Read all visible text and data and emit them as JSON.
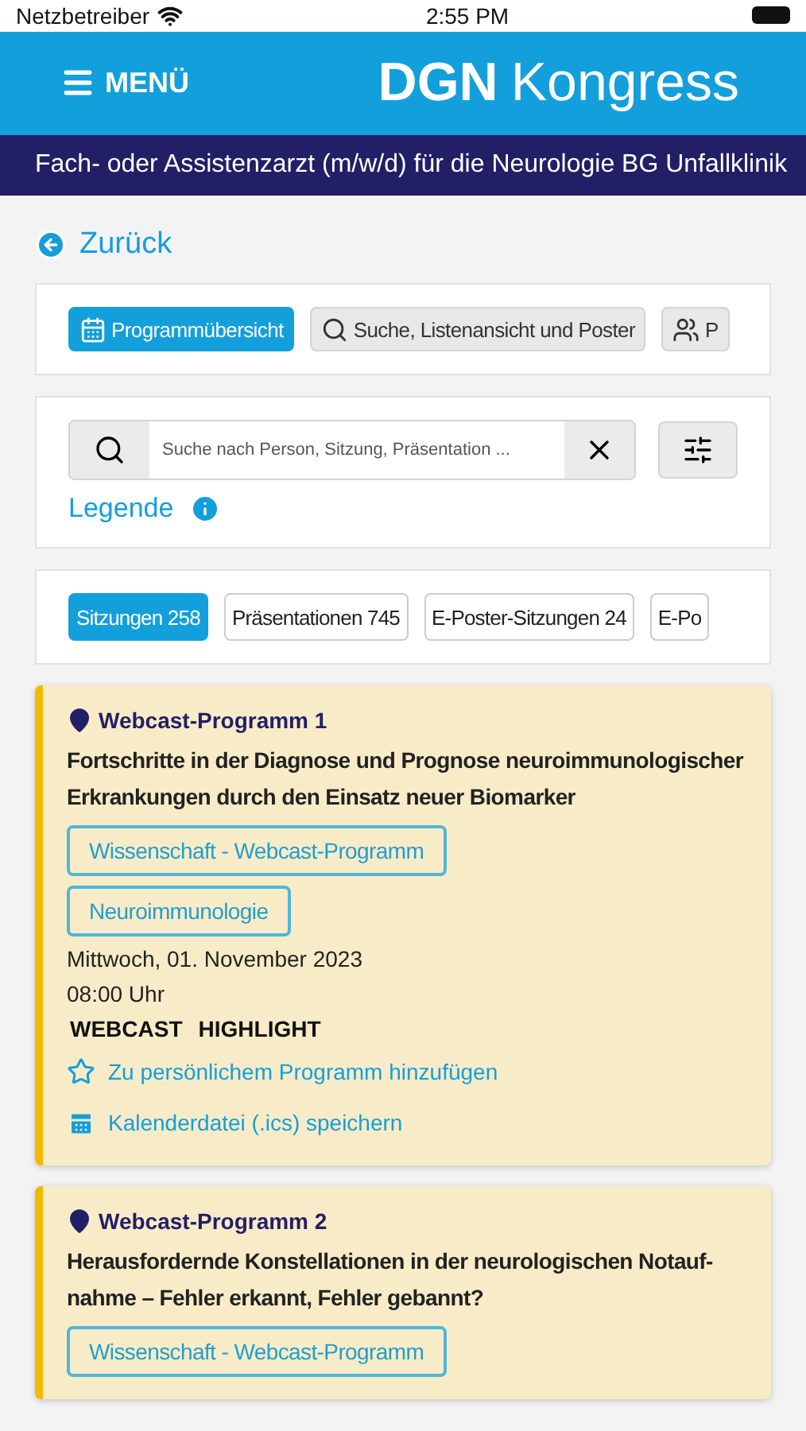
{
  "status_bar": {
    "carrier": "Netzbetreiber",
    "time": "2:55 PM"
  },
  "header": {
    "menu_label": "MENÜ",
    "logo_bold": "DGN",
    "logo_light": "Kongress"
  },
  "banner": {
    "text": "Fach- oder Assistenzarzt (m/w/d) für die Neurologie BG Unfallklinik"
  },
  "back_link": "Zurück",
  "view_tabs": [
    {
      "label": "Programmübersicht",
      "kind": "calendar",
      "selected": true
    },
    {
      "label": "Suche, Listenansicht und Poster",
      "kind": "search",
      "selected": false
    },
    {
      "label": "P",
      "kind": "people",
      "selected": false
    }
  ],
  "search": {
    "placeholder": "Suche nach Person, Sitzung, Präsentation ...",
    "legend": "Legende"
  },
  "category_tabs": [
    {
      "label": "Sitzungen 258",
      "selected": true
    },
    {
      "label": "Präsentationen 745",
      "selected": false
    },
    {
      "label": "E-Poster-Sitzungen 24",
      "selected": false
    },
    {
      "label": "E-Po",
      "selected": false
    }
  ],
  "sessions": [
    {
      "location": "Webcast-Programm 1",
      "title": "Fortschritte in der Diagnose und Prognose neuroimmunologischer Erkrankungen durch den Einsatz neuer Biomarker",
      "tags": [
        "Wissenschaft - Webcast-Programm",
        "Neuroimmunologie"
      ],
      "date": "Mittwoch, 01. November 2023",
      "time": "08:00 Uhr",
      "flags": [
        "WEBCAST",
        "HIGHLIGHT"
      ],
      "actions": [
        {
          "kind": "star",
          "label": "Zu persönlichem Programm hinzufügen"
        },
        {
          "kind": "calendar",
          "label": "Kalenderdatei (.ics) speichern"
        }
      ]
    },
    {
      "location": "Webcast-Programm 2",
      "title": "Herausfordernde Konstellationen in der neurologischen Notauf-nahme – Fehler erkannt, Fehler gebannt?",
      "tags": [
        "Wissenschaft - Webcast-Programm"
      ]
    }
  ]
}
